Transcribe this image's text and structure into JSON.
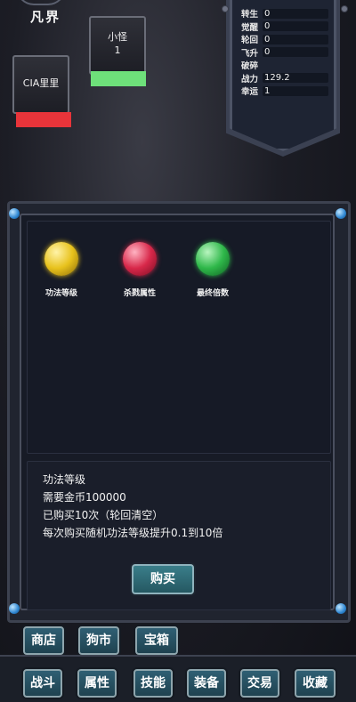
{
  "header": {
    "realm": "凡界"
  },
  "units": [
    {
      "name": "小怪",
      "hp": "1",
      "bar_color": "#6ee07a"
    },
    {
      "name": "CIA里里",
      "hp": "",
      "bar_color": "#e8343a"
    }
  ],
  "stats": [
    {
      "label": "转生",
      "value": "0"
    },
    {
      "label": "觉醒",
      "value": "0"
    },
    {
      "label": "轮回",
      "value": "0"
    },
    {
      "label": "飞升",
      "value": "0"
    },
    {
      "label": "破碎",
      "value": ""
    },
    {
      "label": "战力",
      "value": "129.2"
    },
    {
      "label": "幸运",
      "value": "1"
    }
  ],
  "gems": [
    {
      "label": "功法等级",
      "color": "#e8c21c",
      "icon": "yellow-orb-icon"
    },
    {
      "label": "杀戮属性",
      "color": "#d8284a",
      "icon": "red-orb-icon"
    },
    {
      "label": "最终倍数",
      "color": "#2fb84a",
      "icon": "green-orb-icon"
    }
  ],
  "info": {
    "title": "功法等级",
    "cost": "需要金币100000",
    "bought": "已购买10次（轮回清空）",
    "desc": "每次购买随机功法等级提升0.1到10倍"
  },
  "buy_label": "购买",
  "top_buttons": [
    "商店",
    "狗市",
    "宝箱"
  ],
  "bottom_buttons": [
    "战斗",
    "属性",
    "技能",
    "装备",
    "交易",
    "收藏"
  ]
}
